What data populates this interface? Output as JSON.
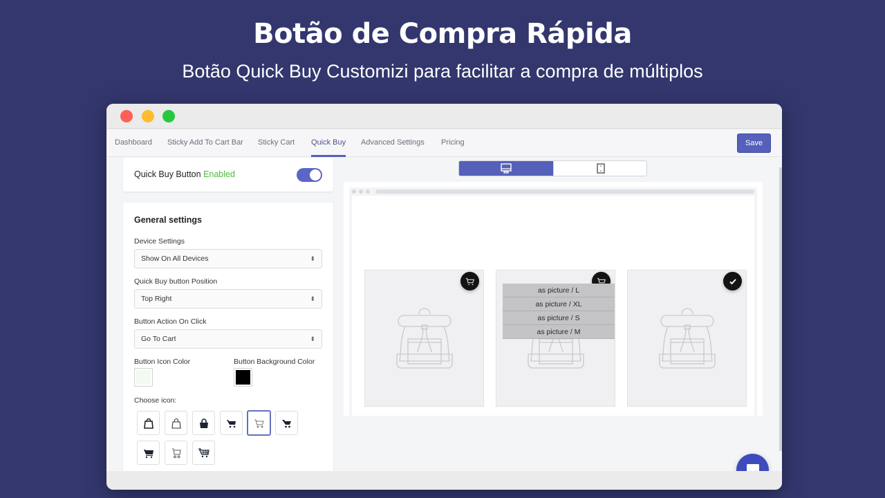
{
  "hero": {
    "title": "Botão de Compra Rápida",
    "subtitle": "Botão Quick Buy Customizi para facilitar a compra de múltiplos"
  },
  "colors": {
    "background": "#33376e",
    "accent": "#5460b9",
    "enabled_green": "#50b83c",
    "chat": "#3d4bbd"
  },
  "nav": {
    "tabs": [
      {
        "label": "Dashboard",
        "active": false
      },
      {
        "label": "Sticky Add To Cart Bar",
        "active": false
      },
      {
        "label": "Sticky Cart",
        "active": false
      },
      {
        "label": "Quick Buy",
        "active": true
      },
      {
        "label": "Advanced Settings",
        "active": false
      },
      {
        "label": "Pricing",
        "active": false
      }
    ],
    "save_label": "Save"
  },
  "toggle_card": {
    "label": "Quick Buy Button",
    "status": "Enabled",
    "enabled": true
  },
  "settings": {
    "title": "General settings",
    "device_label": "Device Settings",
    "device_value": "Show On All Devices",
    "position_label": "Quick Buy button Position",
    "position_value": "Top Right",
    "action_label": "Button Action On Click",
    "action_value": "Go To Cart",
    "icon_color_label": "Button Icon Color",
    "icon_color_value": "#f1fbf1",
    "bg_color_label": "Button Background Color",
    "bg_color_value": "#000000",
    "choose_icon_label": "Choose icon:",
    "icons": [
      "bag-outline-icon",
      "bag-thin-icon",
      "bag-filled-icon",
      "cart-filled-icon",
      "cart-outline-icon",
      "cart-bold-icon",
      "cart-solid-icon",
      "cart-wheels-icon",
      "cart-grid-icon"
    ],
    "selected_icon_index": 4
  },
  "preview": {
    "device_options": [
      "desktop-icon",
      "mobile-icon"
    ],
    "active_device": "desktop",
    "products": [
      {
        "button": "cart-icon"
      },
      {
        "button": "cart-icon",
        "variants": [
          "as picture / L",
          "as picture / XL",
          "as picture / S",
          "as picture / M"
        ]
      },
      {
        "button": "check-icon"
      }
    ]
  }
}
